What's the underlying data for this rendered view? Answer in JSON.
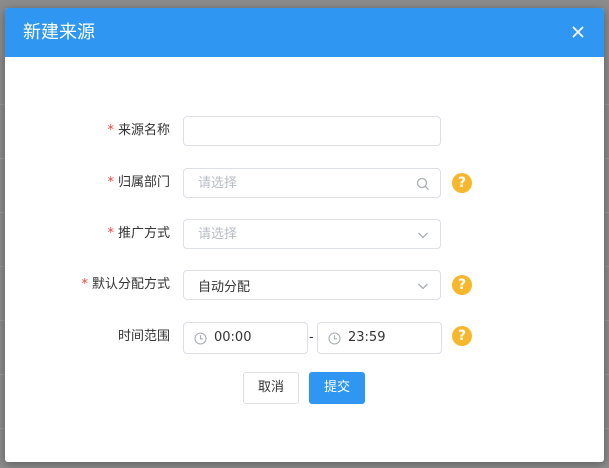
{
  "dialog": {
    "title": "新建来源",
    "close_icon": "close-icon"
  },
  "form": {
    "source_name": {
      "label": "来源名称",
      "required": true,
      "value": "",
      "placeholder": ""
    },
    "department": {
      "label": "归属部门",
      "required": true,
      "placeholder": "请选择",
      "suffix_icon": "search-icon",
      "help_icon": "question-icon"
    },
    "promotion_method": {
      "label": "推广方式",
      "required": true,
      "placeholder": "请选择",
      "suffix_icon": "chevron-down-icon"
    },
    "default_allocation": {
      "label": "默认分配方式",
      "required": true,
      "value": "自动分配",
      "suffix_icon": "chevron-down-icon",
      "help_icon": "question-icon"
    },
    "time_range": {
      "label": "时间范围",
      "required": false,
      "start": "00:00",
      "end": "23:59",
      "separator": "-",
      "help_icon": "question-icon"
    }
  },
  "footer": {
    "cancel_label": "取消",
    "submit_label": "提交"
  },
  "colors": {
    "primary": "#2f97f1",
    "required_mark": "#f2423b",
    "help": "#f6b72d"
  }
}
